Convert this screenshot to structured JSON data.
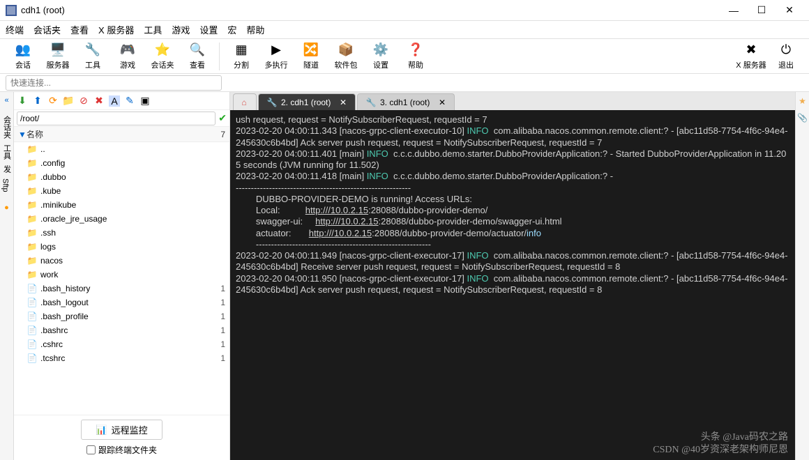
{
  "window": {
    "title": "cdh1 (root)"
  },
  "menu": [
    "终端",
    "会话夹",
    "查看",
    "X 服务器",
    "工具",
    "游戏",
    "设置",
    "宏",
    "帮助"
  ],
  "toolbar": {
    "left": [
      {
        "label": "会话",
        "icon": "👥"
      },
      {
        "label": "服务器",
        "icon": "🖥️"
      },
      {
        "label": "工具",
        "icon": "🔧"
      },
      {
        "label": "游戏",
        "icon": "🎮"
      },
      {
        "label": "会话夹",
        "icon": "⭐"
      },
      {
        "label": "查看",
        "icon": "🔍"
      }
    ],
    "mid": [
      {
        "label": "分割",
        "icon": "▦"
      },
      {
        "label": "多执行",
        "icon": "▶"
      },
      {
        "label": "隧道",
        "icon": "🔀"
      },
      {
        "label": "软件包",
        "icon": "📦"
      },
      {
        "label": "设置",
        "icon": "⚙️"
      },
      {
        "label": "帮助",
        "icon": "❓"
      }
    ],
    "right": [
      {
        "label": "X 服务器",
        "icon": "✖"
      },
      {
        "label": "退出",
        "icon": "⏻"
      }
    ]
  },
  "quick_placeholder": "快速连接...",
  "sidebar": {
    "path": "/root/",
    "header_name": "名称",
    "header_size": "7",
    "items": [
      {
        "name": "..",
        "type": "folder",
        "size": ""
      },
      {
        "name": ".config",
        "type": "folder",
        "size": ""
      },
      {
        "name": ".dubbo",
        "type": "folder",
        "size": ""
      },
      {
        "name": ".kube",
        "type": "folder",
        "size": ""
      },
      {
        "name": ".minikube",
        "type": "folder",
        "size": ""
      },
      {
        "name": ".oracle_jre_usage",
        "type": "folder",
        "size": ""
      },
      {
        "name": ".ssh",
        "type": "folder",
        "size": ""
      },
      {
        "name": "logs",
        "type": "folder",
        "size": ""
      },
      {
        "name": "nacos",
        "type": "folder",
        "size": ""
      },
      {
        "name": "work",
        "type": "folder",
        "size": ""
      },
      {
        "name": ".bash_history",
        "type": "file",
        "size": "1"
      },
      {
        "name": ".bash_logout",
        "type": "file",
        "size": "1"
      },
      {
        "name": ".bash_profile",
        "type": "file",
        "size": "1"
      },
      {
        "name": ".bashrc",
        "type": "file",
        "size": "1"
      },
      {
        "name": ".cshrc",
        "type": "file",
        "size": "1"
      },
      {
        "name": ".tcshrc",
        "type": "file",
        "size": "1"
      }
    ],
    "remote_monitor": "远程监控",
    "track_checkbox": "跟踪终端文件夹"
  },
  "left_tabs": [
    "会话夹",
    "工具",
    "发",
    "Sftp"
  ],
  "tabs": [
    {
      "label": "",
      "home": true
    },
    {
      "label": "2. cdh1 (root)",
      "active": true
    },
    {
      "label": "3. cdh1 (root)",
      "active": false
    }
  ],
  "terminal": {
    "lines": [
      {
        "t": "ush request, request = NotifySubscriberRequest, requestId = 7"
      },
      {
        "t": "2023-02-20 04:00:11.343 [nacos-grpc-client-executor-10] ",
        "info": "INFO",
        "rest": "  com.alibaba.nacos.common.remote.client:? - [abc11d58-7754-4f6c-94e4-245630c6b4bd] Ack server push request, request = NotifySubscriberRequest, requestId = 7"
      },
      {
        "t": "2023-02-20 04:00:11.401 [main] ",
        "info": "INFO",
        "rest": "  c.c.c.dubbo.demo.starter.DubboProviderApplication:? - Started DubboProviderApplication in 11.205 seconds (JVM running for 11.502)"
      },
      {
        "t": "2023-02-20 04:00:11.418 [main] ",
        "info": "INFO",
        "rest": "  c.c.c.dubbo.demo.starter.DubboProviderApplication:? - "
      },
      {
        "t": "----------------------------------------------------------"
      },
      {
        "t": "        DUBBO-PROVIDER-DEMO is running! Access URLs:"
      },
      {
        "t": "        Local:          ",
        "url": "http:///10.0.2.15",
        ":": ":28088/dubbo-provider-demo/"
      },
      {
        "t": "        swagger-ui:     ",
        "url": "http:///10.0.2.15",
        ":": ":28088/dubbo-provider-demo/swagger-ui.html"
      },
      {
        "t": "        actuator:       ",
        "url": "http:///10.0.2.15",
        ":": ":28088/dubbo-provider-demo/actuator/",
        "end": "info"
      },
      {
        "t": "        ----------------------------------------------------------"
      },
      {
        "t": "2023-02-20 04:00:11.949 [nacos-grpc-client-executor-17] ",
        "info": "INFO",
        "rest": "  com.alibaba.nacos.common.remote.client:? - [abc11d58-7754-4f6c-94e4-245630c6b4bd] Receive server push request, request = NotifySubscriberRequest, requestId = 8"
      },
      {
        "t": "2023-02-20 04:00:11.950 [nacos-grpc-client-executor-17] ",
        "info": "INFO",
        "rest": "  com.alibaba.nacos.common.remote.client:? - [abc11d58-7754-4f6c-94e4-245630c6b4bd] Ack server push request, request = NotifySubscriberRequest, requestId = 8"
      }
    ],
    "watermark2": "头条 @Java码农之路",
    "watermark": "CSDN @40岁资深老架构师尼恩"
  }
}
